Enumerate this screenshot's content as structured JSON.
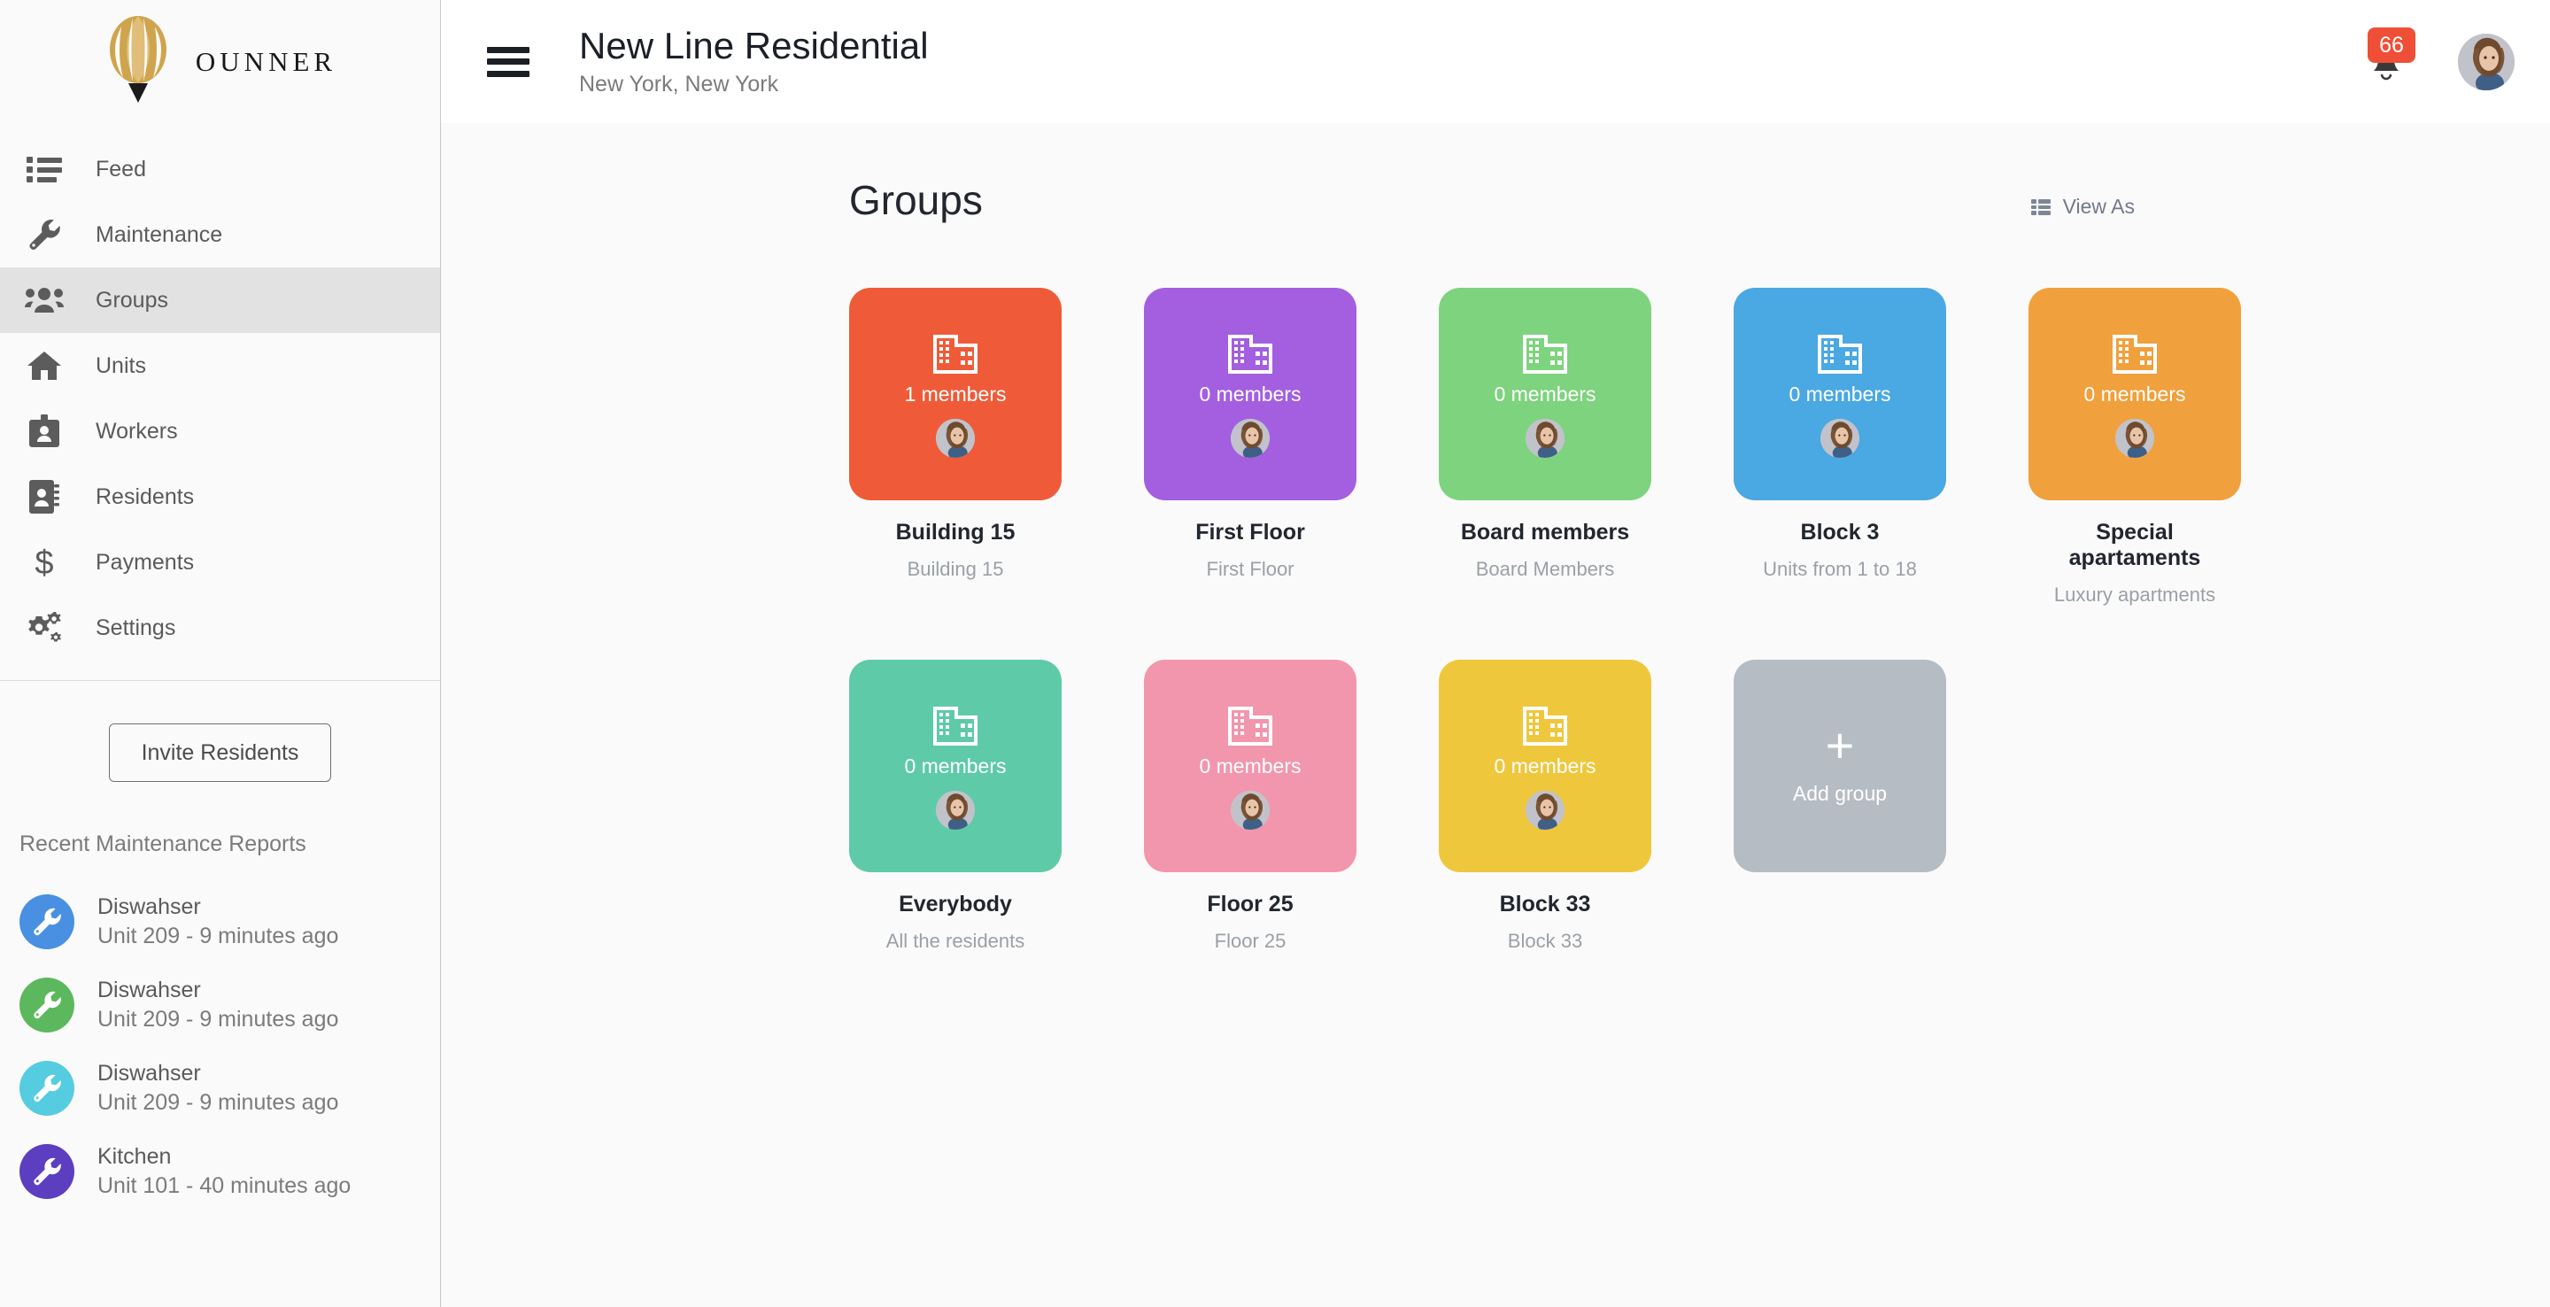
{
  "brand": {
    "name": "OUNNER",
    "logo_icon": "hot-air-balloon-icon"
  },
  "sidebar": {
    "items": [
      {
        "label": "Feed",
        "icon": "list-icon",
        "active": false
      },
      {
        "label": "Maintenance",
        "icon": "wrench-icon",
        "active": false
      },
      {
        "label": "Groups",
        "icon": "people-group-icon",
        "active": true
      },
      {
        "label": "Units",
        "icon": "home-icon",
        "active": false
      },
      {
        "label": "Workers",
        "icon": "id-badge-icon",
        "active": false
      },
      {
        "label": "Residents",
        "icon": "contact-book-icon",
        "active": false
      },
      {
        "label": "Payments",
        "icon": "dollar-sign-icon",
        "active": false
      },
      {
        "label": "Settings",
        "icon": "gears-icon",
        "active": false
      }
    ],
    "invite_button": "Invite Residents",
    "reports_title": "Recent Maintenance Reports",
    "reports": [
      {
        "name": "Diswahser",
        "meta": "Unit 209 - 9 minutes ago",
        "color": "#4a90e2"
      },
      {
        "name": "Diswahser",
        "meta": "Unit 209 - 9 minutes ago",
        "color": "#5cb85c"
      },
      {
        "name": "Diswahser",
        "meta": "Unit 209 - 9 minutes ago",
        "color": "#56cce0"
      },
      {
        "name": "Kitchen",
        "meta": "Unit 101 - 40 minutes ago",
        "color": "#5b3fc0"
      }
    ]
  },
  "topbar": {
    "menu_icon": "hamburger-menu-icon",
    "title": "New Line Residential",
    "subtitle": "New York, New York",
    "notifications": {
      "count": "66",
      "icon": "bell-icon",
      "badge_color": "#ef4f36"
    },
    "avatar_icon": "user-avatar"
  },
  "page": {
    "title": "Groups",
    "view_as": {
      "label": "View As",
      "icon": "list-view-icon"
    },
    "add_group": {
      "label": "Add group",
      "icon": "plus-icon",
      "color": "#b6bcc4"
    },
    "groups": [
      {
        "title": "Building 15",
        "description": "Building 15",
        "members": "1 members",
        "color": "#ef5b38",
        "icon": "building-icon"
      },
      {
        "title": "First Floor",
        "description": "First Floor",
        "members": "0 members",
        "color": "#a35fe0",
        "icon": "building-icon"
      },
      {
        "title": "Board members",
        "description": "Board Members",
        "members": "0 members",
        "color": "#7ed37e",
        "icon": "building-icon"
      },
      {
        "title": "Block 3",
        "description": "Units from 1 to 18",
        "members": "0 members",
        "color": "#4aa8e3",
        "icon": "building-icon"
      },
      {
        "title": "Special apartaments",
        "description": "Luxury apartments",
        "members": "0 members",
        "color": "#f0a03c",
        "icon": "building-icon"
      },
      {
        "title": "Everybody",
        "description": "All the residents",
        "members": "0 members",
        "color": "#5ecaa8",
        "icon": "building-icon"
      },
      {
        "title": "Floor 25",
        "description": "Floor 25",
        "members": "0 members",
        "color": "#f296ad",
        "icon": "building-icon"
      },
      {
        "title": "Block 33",
        "description": "Block 33",
        "members": "0 members",
        "color": "#efc73c",
        "icon": "building-icon"
      }
    ]
  }
}
